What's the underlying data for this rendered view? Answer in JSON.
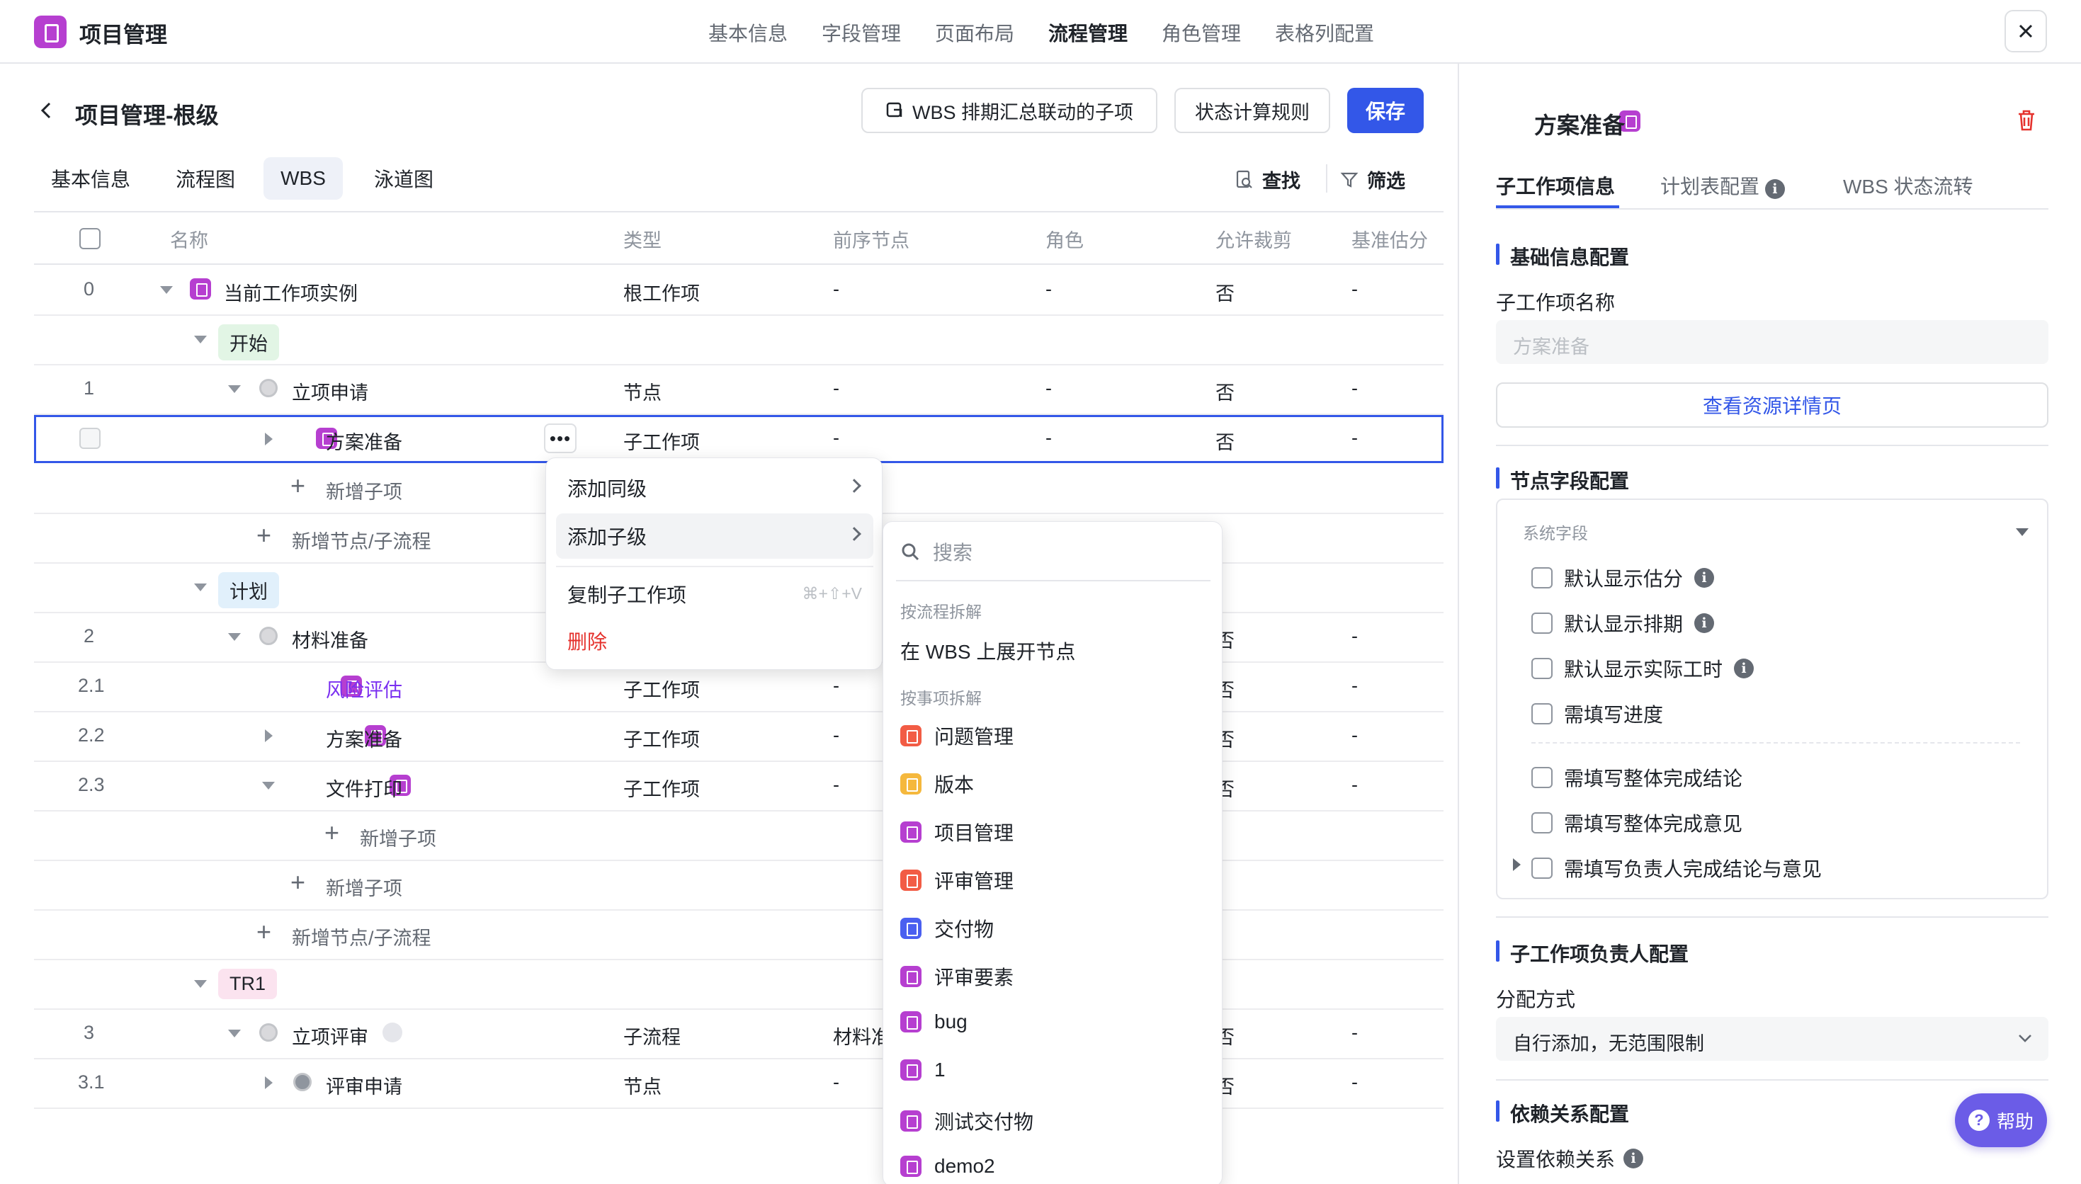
{
  "app": {
    "title": "项目管理"
  },
  "top_tabs": [
    "基本信息",
    "字段管理",
    "页面布局",
    "流程管理",
    "角色管理",
    "表格列配置"
  ],
  "header": {
    "title": "项目管理-根级",
    "wbs_button": "WBS 排期汇总联动的子项",
    "status_rule_button": "状态计算规则",
    "save_button": "保存"
  },
  "sub_tabs": [
    "基本信息",
    "流程图",
    "WBS",
    "泳道图"
  ],
  "toolbar": {
    "find": "查找",
    "filter": "筛选"
  },
  "table": {
    "columns": [
      "名称",
      "类型",
      "前序节点",
      "角色",
      "允许裁剪",
      "基准估分"
    ],
    "rows": [
      {
        "no": "0",
        "name": "当前工作项实例",
        "type": "根工作项",
        "prev": "-",
        "role": "-",
        "cut": "否",
        "est": "-"
      },
      {
        "stage": "开始"
      },
      {
        "no": "1",
        "name": "立项申请",
        "type": "节点",
        "prev": "-",
        "role": "-",
        "cut": "否",
        "est": "-"
      },
      {
        "no": "",
        "name": "方案准备",
        "type": "子工作项",
        "prev": "-",
        "role": "-",
        "cut": "否",
        "est": "-"
      },
      {
        "add": "新增子项"
      },
      {
        "add": "新增节点/子流程"
      },
      {
        "stage": "计划"
      },
      {
        "no": "2",
        "name": "材料准备",
        "type": "",
        "prev": "",
        "role": "",
        "cut": "否",
        "est": "-"
      },
      {
        "no": "2.1",
        "name": "风险评估",
        "type": "子工作项",
        "prev": "-",
        "role": "",
        "cut": "否",
        "est": "-"
      },
      {
        "no": "2.2",
        "name": "方案准备",
        "type": "子工作项",
        "prev": "-",
        "role": "",
        "cut": "否",
        "est": "-"
      },
      {
        "no": "2.3",
        "name": "文件打印",
        "type": "子工作项",
        "prev": "-",
        "role": "",
        "cut": "否",
        "est": "-"
      },
      {
        "add": "新增子项"
      },
      {
        "add": "新增子项"
      },
      {
        "add": "新增节点/子流程"
      },
      {
        "stage": "TR1"
      },
      {
        "no": "3",
        "name": "立项评审",
        "type": "子流程",
        "prev": "材料准",
        "role": "",
        "cut": "否",
        "est": "-"
      },
      {
        "no": "3.1",
        "name": "评审申请",
        "type": "节点",
        "prev": "-",
        "role": "",
        "cut": "否",
        "est": "-"
      }
    ]
  },
  "context_menu": {
    "add_sibling": "添加同级",
    "add_child": "添加子级",
    "copy": "复制子工作项",
    "copy_shortcut": "⌘+⇧+V",
    "delete": "删除"
  },
  "submenu": {
    "search_placeholder": "搜索",
    "group1_label": "按流程拆解",
    "expand_node": "在 WBS 上展开节点",
    "group2_label": "按事项拆解",
    "items": [
      {
        "label": "问题管理",
        "color": "#f25c45"
      },
      {
        "label": "版本",
        "color": "#f5b83d"
      },
      {
        "label": "项目管理",
        "color": "#b63fd0"
      },
      {
        "label": "评审管理",
        "color": "#f25c45"
      },
      {
        "label": "交付物",
        "color": "#4a5ff0"
      },
      {
        "label": "评审要素",
        "color": "#b63fd0"
      },
      {
        "label": "bug",
        "color": "#b63fd0"
      },
      {
        "label": "1",
        "color": "#b63fd0"
      },
      {
        "label": "测试交付物",
        "color": "#b63fd0"
      },
      {
        "label": "demo2",
        "color": "#b63fd0"
      }
    ]
  },
  "right_panel": {
    "title": "方案准备",
    "tabs": [
      "子工作项信息",
      "计划表配置",
      "WBS 状态流转"
    ],
    "basic_section": "基础信息配置",
    "name_label": "子工作项名称",
    "name_placeholder": "方案准备",
    "view_resource": "查看资源详情页",
    "node_section": "节点字段配置",
    "system_fields": "系统字段",
    "checkboxes": [
      "默认显示估分",
      "默认显示排期",
      "默认显示实际工时",
      "需填写进度",
      "需填写整体完成结论",
      "需填写整体完成意见",
      "需填写负责人完成结论与意见"
    ],
    "owner_section": "子工作项负责人配置",
    "assign_label": "分配方式",
    "assign_value": "自行添加，无范围限制",
    "dep_section": "依赖关系配置",
    "dep_label": "设置依赖关系",
    "help": "帮助"
  }
}
